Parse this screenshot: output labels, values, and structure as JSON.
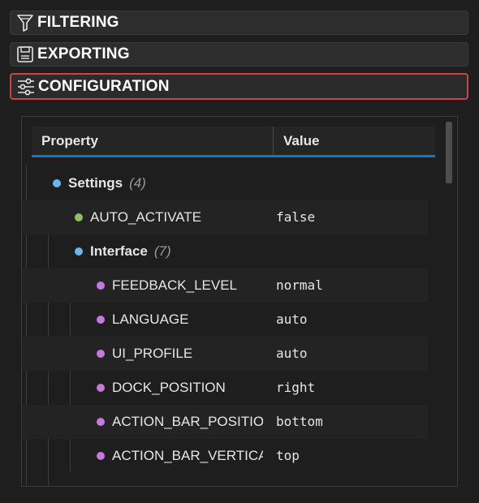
{
  "sections": [
    {
      "label": "FILTERING",
      "icon": "filter-icon"
    },
    {
      "label": "EXPORTING",
      "icon": "save-icon"
    },
    {
      "label": "CONFIGURATION",
      "icon": "sliders-icon"
    }
  ],
  "grid": {
    "columns": {
      "property": "Property",
      "value": "Value"
    },
    "rows": [
      {
        "name": "Settings",
        "count": "(4)",
        "value": "",
        "group": true,
        "color": "#6cb4ee"
      },
      {
        "name": "AUTO_ACTIVATE",
        "count": "",
        "value": "false",
        "group": false,
        "color": "#8fbf5f"
      },
      {
        "name": "Interface",
        "count": "(7)",
        "value": "",
        "group": true,
        "color": "#6cb4ee"
      },
      {
        "name": "FEEDBACK_LEVEL",
        "count": "",
        "value": "normal",
        "group": false,
        "color": "#c678dd"
      },
      {
        "name": "LANGUAGE",
        "count": "",
        "value": "auto",
        "group": false,
        "color": "#c678dd"
      },
      {
        "name": "UI_PROFILE",
        "count": "",
        "value": "auto",
        "group": false,
        "color": "#c678dd"
      },
      {
        "name": "DOCK_POSITION",
        "count": "",
        "value": "right",
        "group": false,
        "color": "#c678dd"
      },
      {
        "name": "ACTION_BAR_POSITION",
        "count": "",
        "value": "bottom",
        "group": false,
        "color": "#c678dd"
      },
      {
        "name": "ACTION_BAR_VERTICAL",
        "count": "",
        "value": "top",
        "group": false,
        "color": "#c678dd"
      }
    ]
  }
}
